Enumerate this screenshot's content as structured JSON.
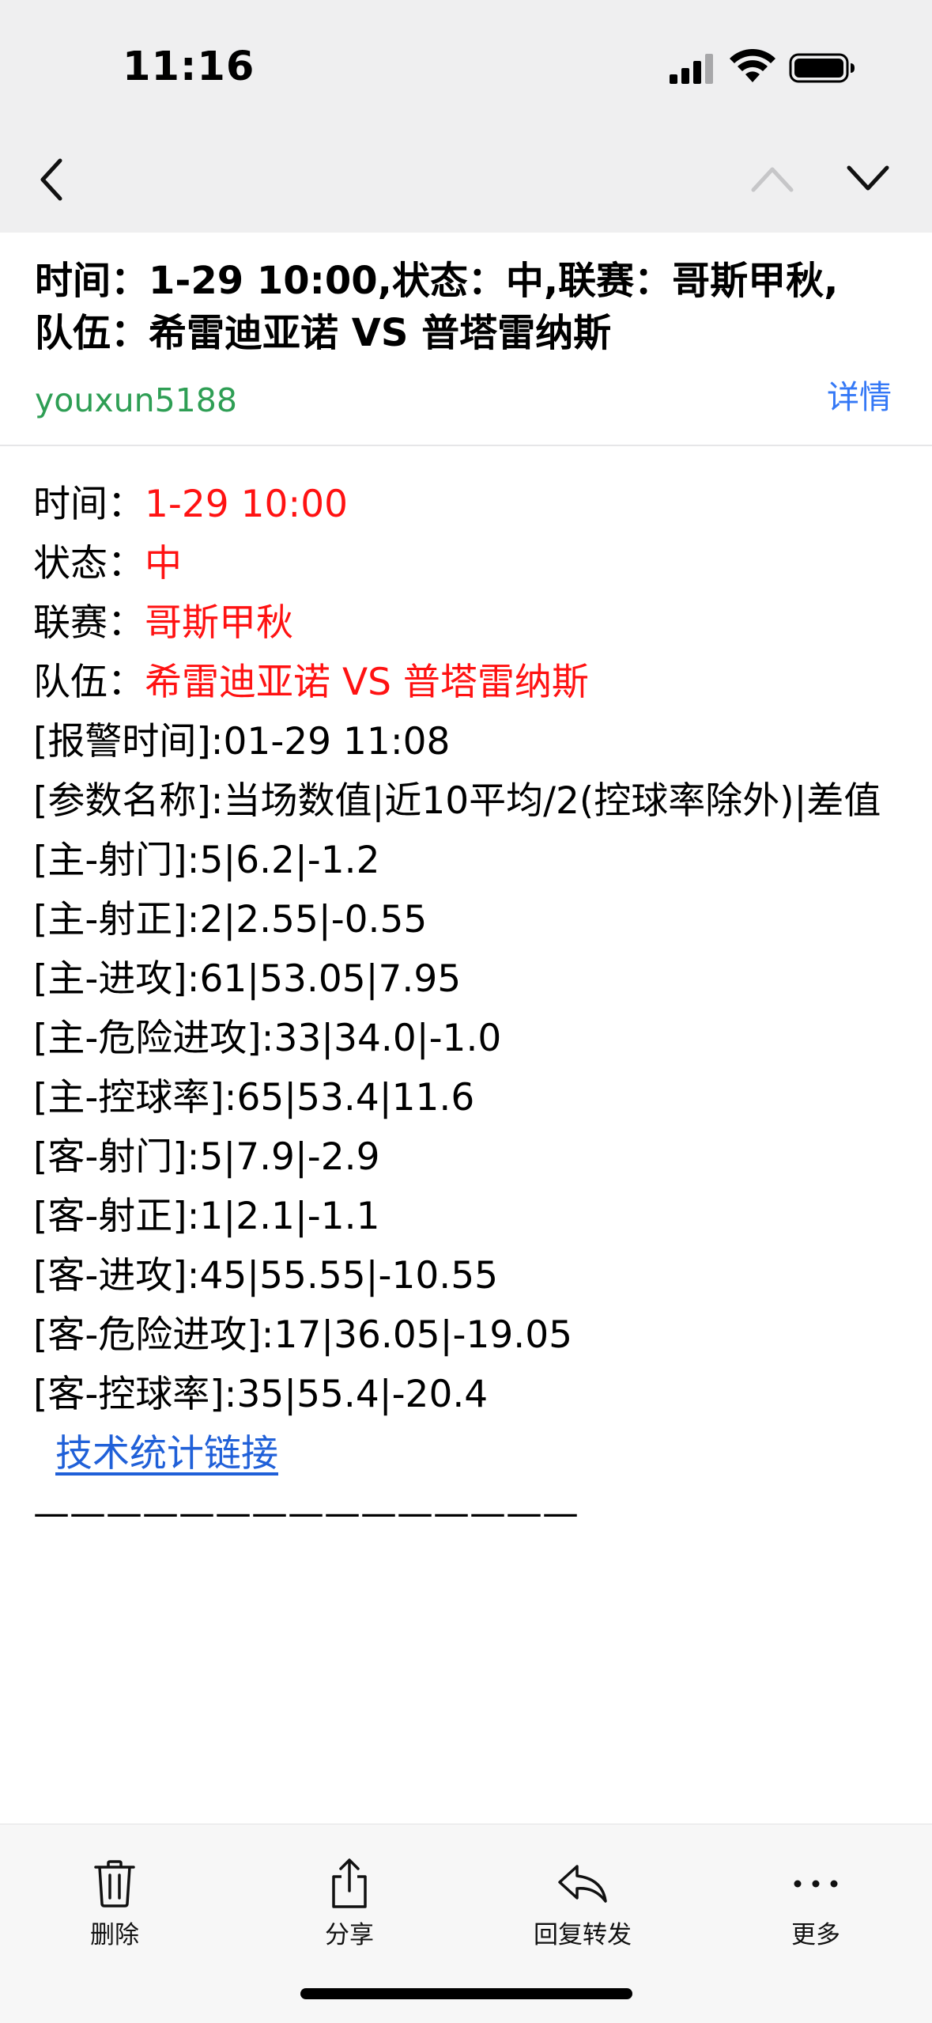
{
  "status_bar": {
    "time": "11:16"
  },
  "email": {
    "subject_line1": "时间：1-29 10:00,状态：中,联赛：哥斯甲秋,",
    "subject_line2": "队伍：希雷迪亚诺 VS 普塔雷纳斯",
    "sender": "youxun5188",
    "details_label": "详情"
  },
  "body": {
    "time_label": "时间：",
    "time_value": "1-29 10:00",
    "status_label": "状态：",
    "status_value": "中",
    "league_label": "联赛：",
    "league_value": "哥斯甲秋",
    "teams_label": "队伍：",
    "teams_value": "希雷迪亚诺 VS 普塔雷纳斯",
    "alarm_time": "[报警时间]:01-29 11:08",
    "param_names": "[参数名称]:当场数值|近10平均/2(控球率除外)|差值",
    "stats": [
      "[主-射门]:5|6.2|-1.2",
      "[主-射正]:2|2.55|-0.55",
      "[主-进攻]:61|53.05|7.95",
      "[主-危险进攻]:33|34.0|-1.0",
      "[主-控球率]:65|53.4|11.6",
      "[客-射门]:5|7.9|-2.9",
      "[客-射正]:1|2.1|-1.1",
      "[客-进攻]:45|55.55|-10.55",
      "[客-危险进攻]:17|36.05|-19.05",
      "[客-控球率]:35|55.4|-20.4"
    ],
    "stats_link": "技术统计链接",
    "separator": "———————————————"
  },
  "toolbar": {
    "delete_label": "删除",
    "share_label": "分享",
    "reply_label": "回复转发",
    "more_label": "更多"
  },
  "colors": {
    "highlight_red": "#ff1212",
    "sender_green": "#2e9e54",
    "link_blue": "#3478f6",
    "body_link_blue": "#2060d8"
  }
}
